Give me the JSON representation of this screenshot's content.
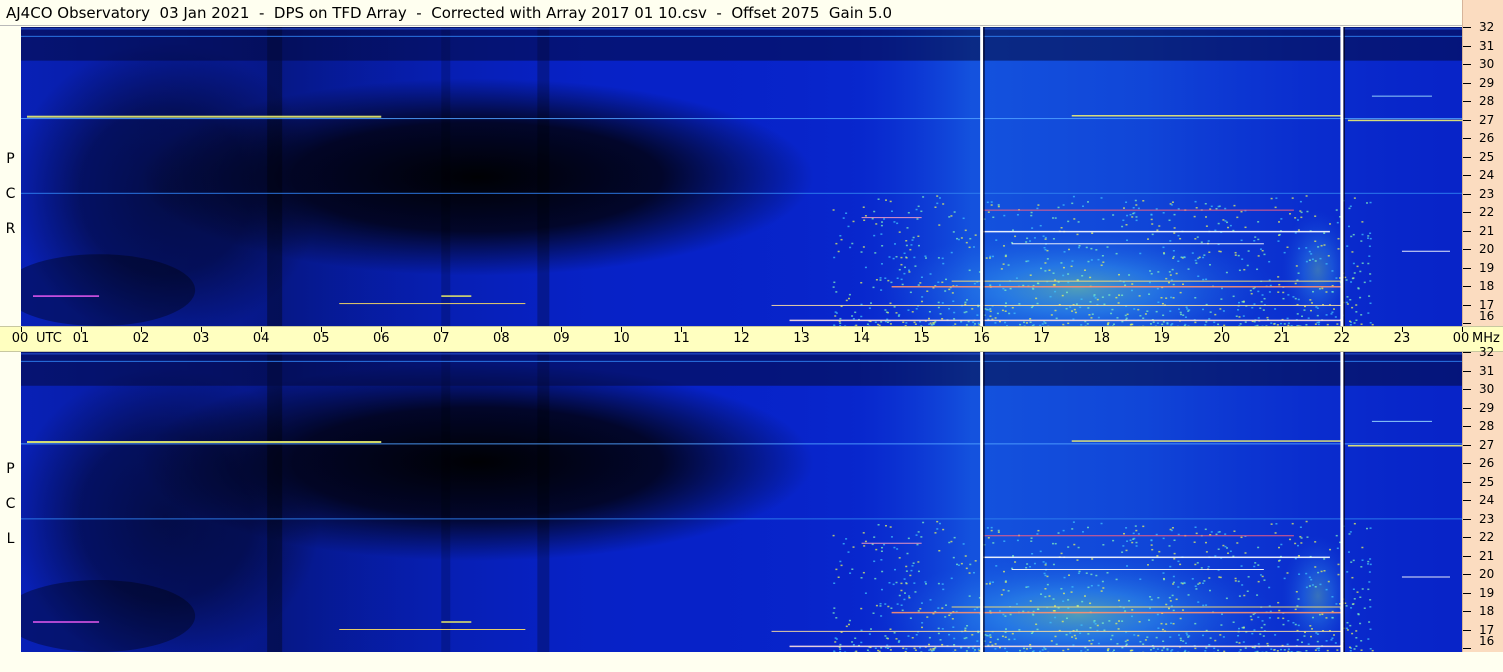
{
  "title": "AJ4CO Observatory  03 Jan 2021  -  DPS on TFD Array  -  Corrected with Array 2017 01 10.csv  -  Offset 2075  Gain 5.0",
  "panels": [
    {
      "id": "rcp",
      "label": [
        "R",
        "C",
        "P"
      ]
    },
    {
      "id": "lcp",
      "label": [
        "L",
        "C",
        "P"
      ]
    }
  ],
  "time_axis": {
    "labels": [
      "00",
      "01",
      "02",
      "03",
      "04",
      "05",
      "06",
      "07",
      "08",
      "09",
      "10",
      "11",
      "12",
      "13",
      "14",
      "15",
      "16",
      "17",
      "18",
      "19",
      "20",
      "21",
      "22",
      "23",
      "00"
    ],
    "utc_label": "UTC",
    "freq_unit": "MHz"
  },
  "freq_axis": {
    "labels": [
      "32",
      "31",
      "30",
      "29",
      "28",
      "27",
      "26",
      "25",
      "24",
      "23",
      "22",
      "21",
      "20",
      "19",
      "18",
      "17",
      "16"
    ]
  },
  "colors": {
    "background_blue": "#0722c8",
    "dark": "#02030e",
    "marker_line": "#ffffff",
    "time_axis_bg": "#ffffc0",
    "freq_axis_bg": "#fbdcc0"
  },
  "chart_data": {
    "type": "heatmap",
    "title": "AJ4CO Observatory  03 Jan 2021  -  DPS on TFD Array  -  Corrected with Array 2017 01 10.csv  -  Offset 2075  Gain 5.0",
    "x_range_utc_hours": [
      0,
      24
    ],
    "y_range_mhz": [
      16,
      32
    ],
    "series": [
      {
        "name": "RCP"
      },
      {
        "name": "LCP"
      }
    ],
    "time_markers_utc": [
      16,
      22
    ],
    "interference_bands_mhz": [
      27.1,
      17.6,
      20.4,
      21.0,
      22.2
    ]
  }
}
